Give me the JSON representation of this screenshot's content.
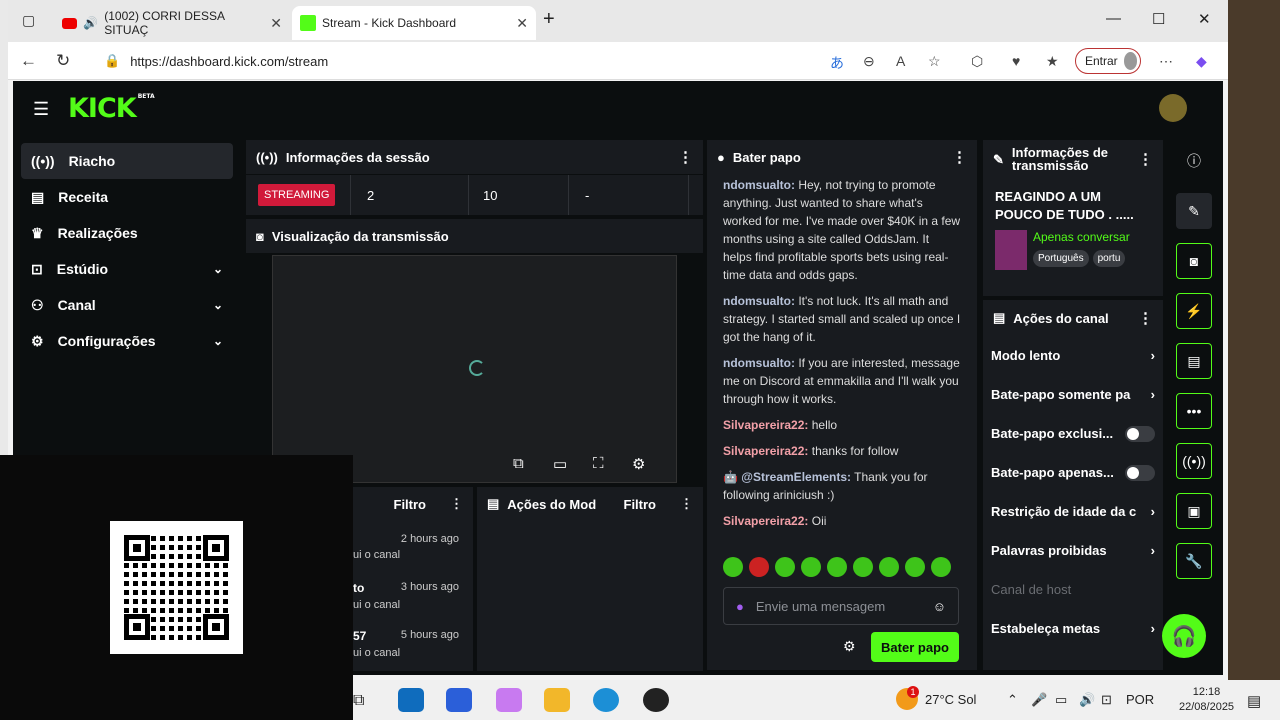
{
  "browser": {
    "tabs": [
      {
        "label": "(1002) CORRI DESSA SITUAÇ"
      },
      {
        "label": "Stream - Kick Dashboard"
      }
    ],
    "url": "https://dashboard.kick.com/stream",
    "signin_label": "Entrar"
  },
  "app": {
    "logo": "KICK",
    "logo_badge": "BETA",
    "sidebar": {
      "items": [
        {
          "label": "Riacho",
          "icon": "broadcast-icon"
        },
        {
          "label": "Receita",
          "icon": "receipt-icon"
        },
        {
          "label": "Realizações",
          "icon": "trophy-icon"
        },
        {
          "label": "Estúdio",
          "icon": "studio-icon"
        },
        {
          "label": "Canal",
          "icon": "people-icon"
        },
        {
          "label": "Configurações",
          "icon": "gear-icon"
        }
      ]
    },
    "session": {
      "title": "Informações da sessão",
      "status": "STREAMING",
      "values": [
        "2",
        "10",
        "-"
      ]
    },
    "preview": {
      "title": "Visualização da transmissão"
    },
    "bottom_left": {
      "filter": "Filtro",
      "rows": [
        {
          "time": "2 hours ago",
          "text": "ui o canal"
        },
        {
          "time": "3 hours ago",
          "text": "ui o canal",
          "name": "to"
        },
        {
          "time": "5 hours ago",
          "text": "ui o canal",
          "name": "57"
        }
      ]
    },
    "mod_actions": {
      "title": "Ações do Mod",
      "filter": "Filtro"
    },
    "chat": {
      "title": "Bater papo",
      "messages": [
        {
          "user": "ndomsualto:",
          "text": "Hey, not trying to promote anything. Just wanted to share what's worked for me. I've made over $40K in a few months using a site called OddsJam. It helps find profitable sports bets using real-time data and odds gaps."
        },
        {
          "user": "ndomsualto:",
          "text": "It's not luck. It's all math and strategy. I started small and scaled up once I got the hang of it."
        },
        {
          "user": "ndomsualto:",
          "text": "If you are interested, message me on Discord at emmakilla and I'll walk you through how it works."
        },
        {
          "user": "Silvapereira22:",
          "text": "hello"
        },
        {
          "user": "Silvapereira22:",
          "text": "thanks for follow"
        },
        {
          "user": "@StreamElements:",
          "text": "Thank you for following ariniciush :)"
        },
        {
          "user": "Silvapereira22:",
          "text": "Oii"
        }
      ],
      "input_placeholder": "Envie uma mensagem",
      "send_label": "Bater papo"
    },
    "stream_info": {
      "title": "Informações de transmissão",
      "stream_title": "REAGINDO A UM POUCO DE TUDO . .....",
      "category": "Apenas conversar",
      "tags": [
        "Português",
        "portu"
      ]
    },
    "channel_actions": {
      "title": "Ações do canal",
      "rows": [
        {
          "label": "Modo lento"
        },
        {
          "label": "Bate-papo somente pa"
        },
        {
          "label": "Bate-papo exclusi..."
        },
        {
          "label": "Bate-papo apenas..."
        },
        {
          "label": "Restrição de idade da c"
        },
        {
          "label": "Palavras proibidas"
        },
        {
          "label": "Canal de host"
        },
        {
          "label": "Estabeleça metas"
        }
      ]
    }
  },
  "taskbar": {
    "weather": "27°C  Sol",
    "lang": "POR",
    "time": "12:18",
    "date": "22/08/2025",
    "notif": "1"
  }
}
